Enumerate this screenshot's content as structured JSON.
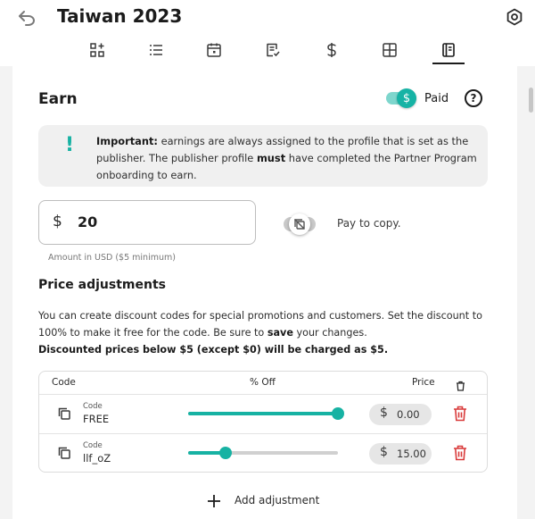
{
  "header": {
    "title": "Taiwan 2023",
    "back_icon": "back-arrow-icon",
    "settings_icon": "gear-icon"
  },
  "nav": {
    "tabs": [
      {
        "icon": "dashboard-add-icon",
        "active": false
      },
      {
        "icon": "list-icon",
        "active": false
      },
      {
        "icon": "calendar-icon",
        "active": false
      },
      {
        "icon": "checklist-icon",
        "active": false
      },
      {
        "icon": "dollar-icon",
        "active": false
      },
      {
        "icon": "layout-icon",
        "active": false
      },
      {
        "icon": "notebook-icon",
        "active": true
      }
    ]
  },
  "earn": {
    "title": "Earn",
    "paid_toggle": {
      "symbol": "$",
      "label": "Paid",
      "on": true
    },
    "help_symbol": "?",
    "info": {
      "bang": "!",
      "important_label": "Important:",
      "text_1": " earnings are always assigned to the profile that is set as the publisher. The publisher profile ",
      "must": "must",
      "text_2": " have completed the Partner Program onboarding to earn."
    },
    "amount": {
      "currency": "$",
      "value": "20",
      "hint": "Amount in USD ($5 minimum)"
    },
    "copy_toggle": {
      "label": "Pay to copy.",
      "on": false
    }
  },
  "adjustments": {
    "title": "Price adjustments",
    "desc_1": "You can create discount codes for special promotions and customers. Set the discount to 100% to make it free for the code. Be sure to ",
    "save": "save",
    "desc_2": " your changes.",
    "desc_bold": "Discounted prices below $5 (except $0) will be charged as $5.",
    "columns": {
      "code": "Code",
      "off": "% Off",
      "price": "Price"
    },
    "rows": [
      {
        "code_label": "Code",
        "code": "FREE",
        "percent_off": 100,
        "currency": "$",
        "price": "0.00"
      },
      {
        "code_label": "Code",
        "code": "llf_oZ",
        "percent_off": 25,
        "currency": "$",
        "price": "15.00"
      }
    ],
    "add_label": "Add adjustment"
  },
  "colors": {
    "accent": "#17b2a3",
    "danger": "#d93a3a"
  }
}
